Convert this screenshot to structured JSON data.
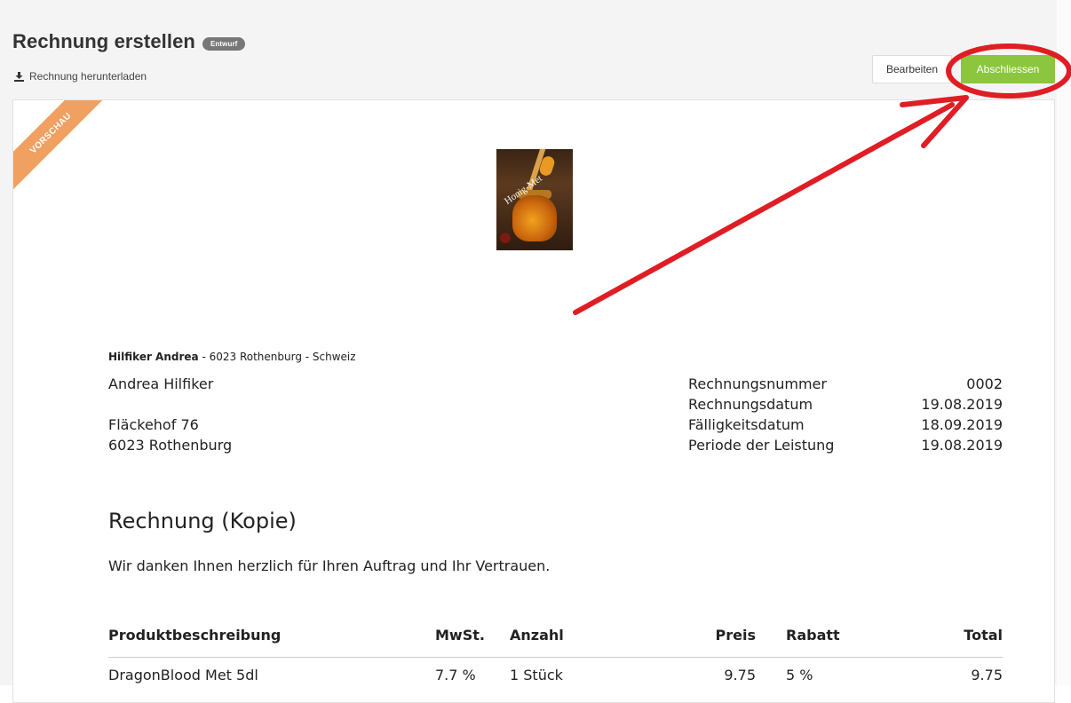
{
  "header": {
    "title": "Rechnung erstellen",
    "status_badge": "Entwurf",
    "download_label": "Rechnung herunterladen",
    "edit_button": "Bearbeiten",
    "finish_button": "Abschliessen"
  },
  "preview_ribbon": "VORSCHAU",
  "logo_text": "Honig-Met",
  "sender_line": {
    "name": "Hilfiker Andrea",
    "rest": " - 6023 Rothenburg - Schweiz"
  },
  "recipient": {
    "name": "Andrea Hilfiker",
    "street": "Fläckehof 76",
    "city": "6023 Rothenburg"
  },
  "meta": [
    {
      "label": "Rechnungsnummer",
      "value": "0002"
    },
    {
      "label": "Rechnungsdatum",
      "value": "19.08.2019"
    },
    {
      "label": "Fälligkeitsdatum",
      "value": "18.09.2019"
    },
    {
      "label": "Periode der Leistung",
      "value": "19.08.2019"
    }
  ],
  "heading": "Rechnung (Kopie)",
  "thanks": "Wir danken Ihnen herzlich für Ihren Auftrag und Ihr Vertrauen.",
  "table": {
    "headers": {
      "description": "Produktbeschreibung",
      "vat": "MwSt.",
      "quantity": "Anzahl",
      "price": "Preis",
      "discount": "Rabatt",
      "total": "Total"
    },
    "rows": [
      {
        "description": "DragonBlood Met 5dl",
        "vat": "7.7 %",
        "quantity": "1 Stück",
        "price": "9.75",
        "discount": "5 %",
        "total": "9.75"
      }
    ]
  },
  "colors": {
    "finish_button": "#8cc63e",
    "ribbon": "#f0a061",
    "annotation": "#e01d24"
  },
  "icons": {
    "download": "download-icon"
  }
}
